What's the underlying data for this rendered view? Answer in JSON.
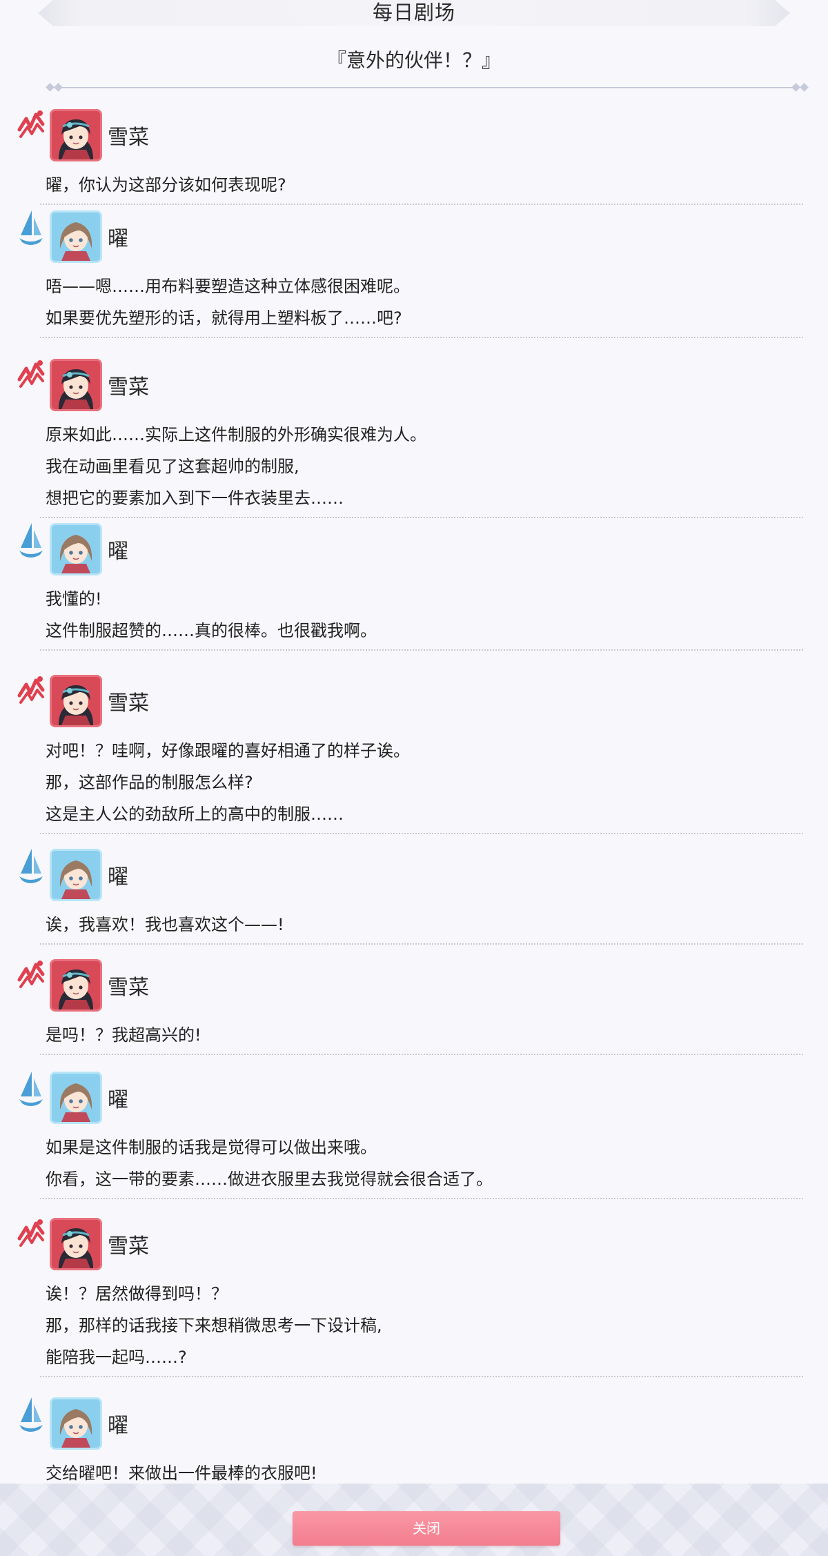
{
  "header": {
    "title": "每日剧场"
  },
  "story": {
    "title": "『意外的伙伴！？』"
  },
  "dialogue": [
    {
      "speaker": "雪菜",
      "lines": [
        "曜，你认为这部分该如何表现呢?"
      ]
    },
    {
      "speaker": "曜",
      "lines": [
        "唔——嗯……用布料要塑造这种立体感很困难呢。",
        "如果要优先塑形的话，就得用上塑料板了……吧?"
      ]
    },
    {
      "speaker": "雪菜",
      "lines": [
        "原来如此……实际上这件制服的外形确实很难为人。",
        "我在动画里看见了这套超帅的制服,",
        "想把它的要素加入到下一件衣装里去……"
      ]
    },
    {
      "speaker": "曜",
      "lines": [
        "我懂的!",
        "这件制服超赞的……真的很棒。也很戳我啊。"
      ]
    },
    {
      "speaker": "雪菜",
      "lines": [
        "对吧！？哇啊，好像跟曜的喜好相通了的样子诶。",
        "那，这部作品的制服怎么样?",
        "这是主人公的劲敌所上的高中的制服……"
      ]
    },
    {
      "speaker": "曜",
      "lines": [
        "诶，我喜欢！我也喜欢这个——!"
      ]
    },
    {
      "speaker": "雪菜",
      "lines": [
        "是吗！？我超高兴的!"
      ]
    },
    {
      "speaker": "曜",
      "lines": [
        "如果是这件制服的话我是觉得可以做出来哦。",
        "你看，这一带的要素……做进衣服里去我觉得就会很合适了。"
      ]
    },
    {
      "speaker": "雪菜",
      "lines": [
        "诶！？居然做得到吗！？",
        "那，那样的话我接下来想稍微思考一下设计稿,",
        "能陪我一起吗……?"
      ]
    },
    {
      "speaker": "曜",
      "lines": [
        "交给曜吧！来做出一件最棒的衣服吧!"
      ]
    }
  ],
  "footer": {
    "close_label": "关闭"
  },
  "colors": {
    "accent_pink": "#f27d8e",
    "setsuna_red": "#d84a58",
    "you_blue": "#8ad0ee"
  }
}
